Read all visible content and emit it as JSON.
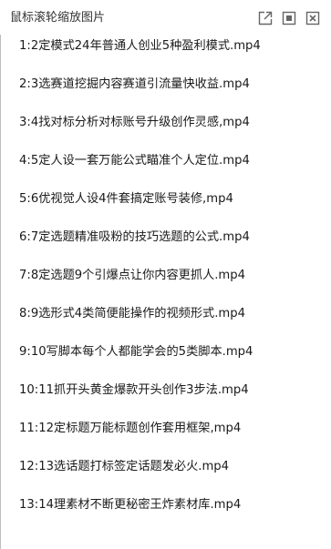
{
  "window": {
    "title": "鼠标滚轮缩放图片",
    "controls": {
      "share_icon": "share-external-icon",
      "maximize_icon": "maximize-icon",
      "close_icon": "close-icon"
    }
  },
  "files": [
    "1:2定模式24年普通人创业5种盈利模式.mp4",
    "2:3选赛道挖掘内容赛道引流量快收益.mp4",
    "3:4找对标分析对标账号升级创作灵感,mp4",
    "4:5定人设一套万能公式瞄准个人定位.mp4",
    "5:6优视觉人设4件套搞定账号装修,mp4",
    "6:7定选题精准吸粉的技巧选题的公式.mp4",
    "7:8定选题9个引爆点让你内容更抓人.mp4",
    "8:9选形式4类简便能操作的视频形式.mp4",
    "9:10写脚本每个人都能学会的5类脚本.mp4",
    "10:11抓开头黄金爆款开头创作3步法.mp4",
    "11:12定标题万能标题创作套用框架,mp4",
    "12:13选话题打标签定话题发必火.mp4",
    "13:14理素材不断更秘密王炸素材库.mp4"
  ],
  "colors": {
    "text": "#1a1a1a",
    "title_text": "#333333",
    "icon": "#666666",
    "border": "#bdbdbd",
    "background": "#ffffff"
  }
}
